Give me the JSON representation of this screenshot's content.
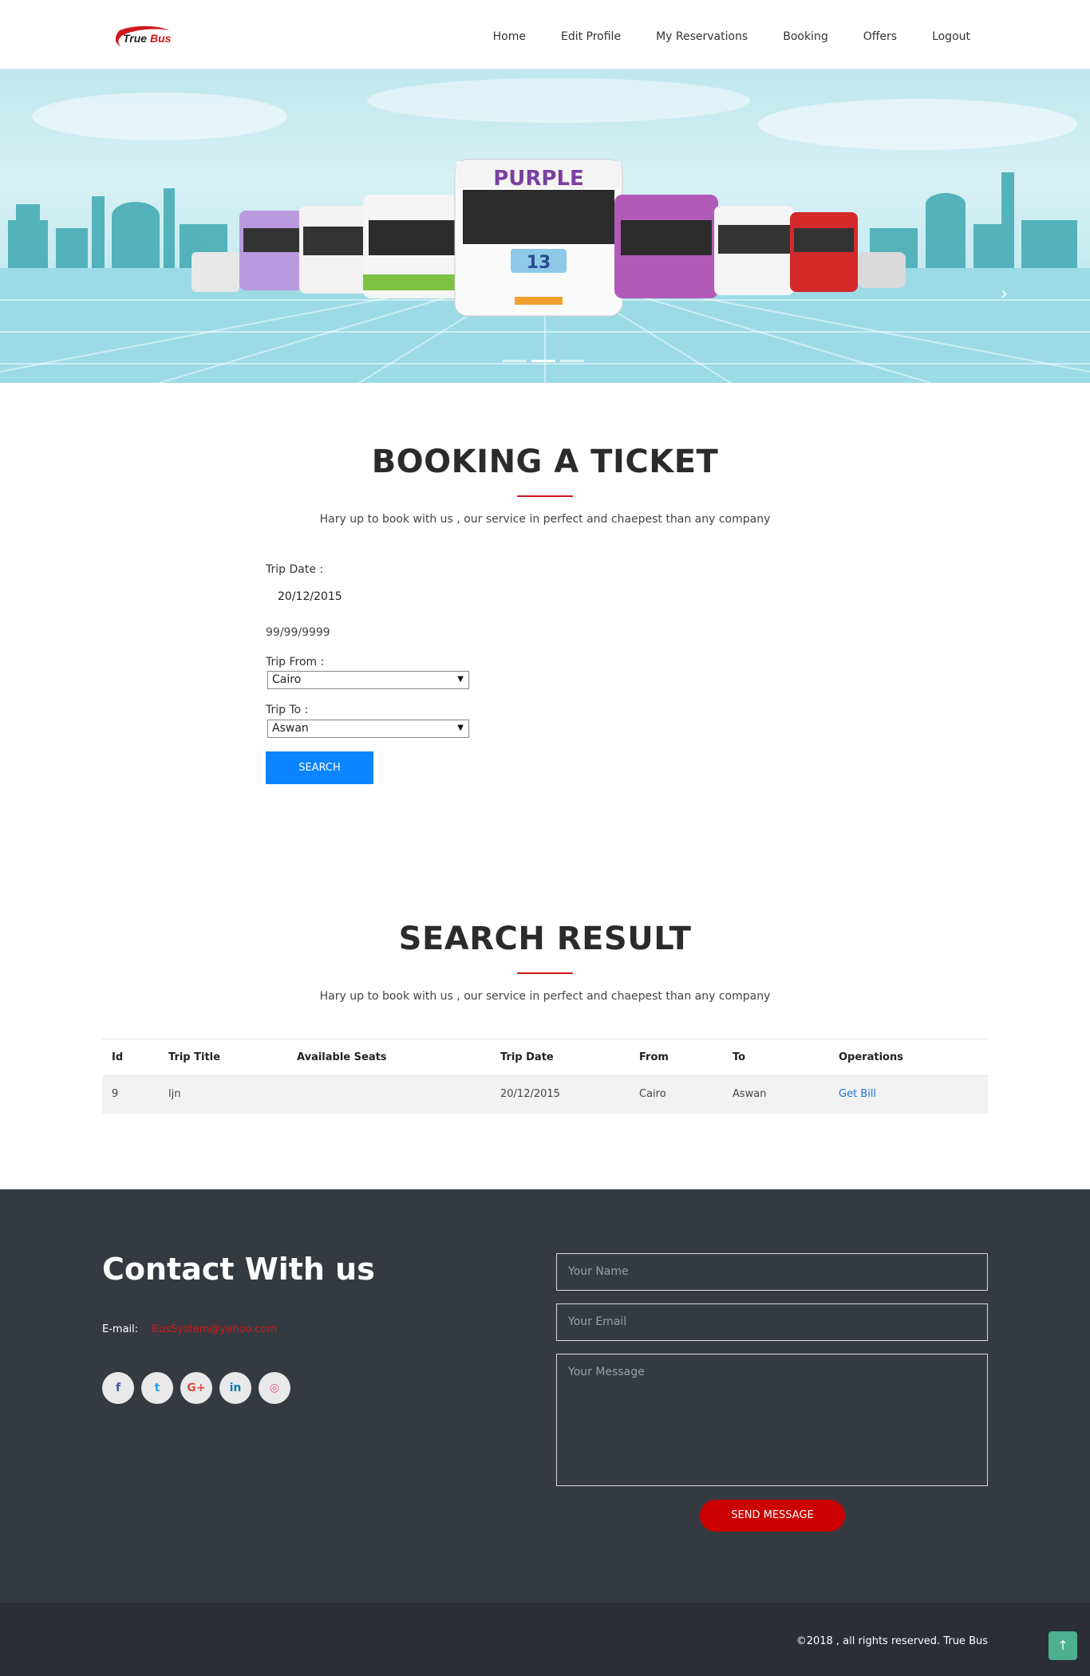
{
  "header": {
    "logo_text_1": "True",
    "logo_text_2": " Bus",
    "nav": [
      "Home",
      "Edit Profile",
      "My Reservations",
      "Booking",
      "Offers",
      "Logout"
    ]
  },
  "hero": {
    "bus_label": "PURPLE",
    "bus_number": "13",
    "active_slide": 2,
    "slide_count": 3
  },
  "booking": {
    "title": "BOOKING A TICKET",
    "subtitle": "Hary up to book with us , our service in perfect and chaepest than any company",
    "trip_date_label": "Trip Date :",
    "trip_date_value": "20/12/2015",
    "date_mask": "99/99/9999",
    "trip_from_label": "Trip From :",
    "trip_from_value": "Cairo",
    "trip_to_label": "Trip To :",
    "trip_to_value": "Aswan",
    "search_label": "SEARCH"
  },
  "results": {
    "title": "SEARCH RESULT",
    "subtitle": "Hary up to book with us , our service in perfect and chaepest than any company",
    "columns": [
      "Id",
      "Trip Title",
      "Available Seats",
      "Trip Date",
      "From",
      "To",
      "Operations"
    ],
    "rows": [
      {
        "id": "9",
        "title": "ljn",
        "seats": "",
        "date": "20/12/2015",
        "from": "Cairo",
        "to": "Aswan",
        "operation": "Get Bill"
      }
    ]
  },
  "contact": {
    "title": "Contact With us",
    "email_label": "E-mail:",
    "email_value": "BusSystem@yahoo.com",
    "socials": [
      "facebook-icon",
      "twitter-icon",
      "google-plus-icon",
      "linkedin-icon",
      "dribbble-icon"
    ],
    "social_glyphs": [
      "f",
      "t",
      "G+",
      "in",
      "◎"
    ],
    "social_colors": [
      "#3b5998",
      "#1da1f2",
      "#dd4b39",
      "#0077b5",
      "#ea4c89"
    ],
    "name_placeholder": "Your Name",
    "email_placeholder": "Your Email",
    "message_placeholder": "Your Message",
    "send_label": "SEND MESSAGE"
  },
  "footer": {
    "copyright": "©2018 , all rights reserved. True Bus",
    "to_top_glyph": "↑"
  },
  "colors": {
    "accent_red": "#d0181e",
    "primary_blue": "#0a84ff",
    "footer_bg": "#343a40",
    "bottom_bg": "#2b2f35"
  }
}
